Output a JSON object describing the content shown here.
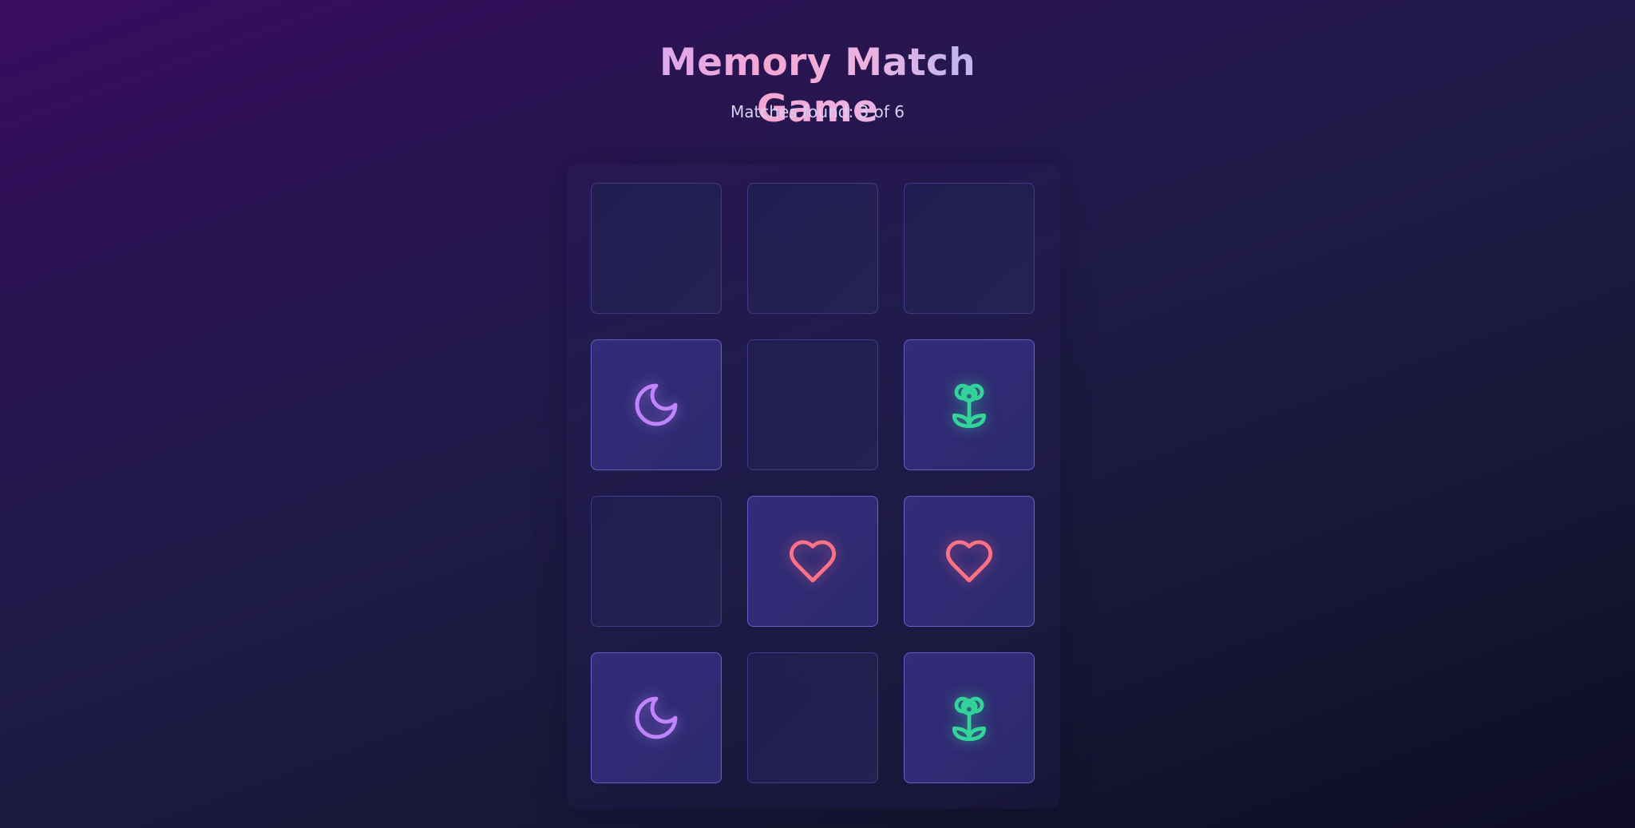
{
  "title": "Memory Match Game",
  "status": "Matches found: 3 of 6",
  "colors": {
    "moon": "#c084fc",
    "flower": "#34d399",
    "heart": "#fb7185"
  },
  "cards": [
    {
      "face_up": false,
      "icon": null
    },
    {
      "face_up": false,
      "icon": null
    },
    {
      "face_up": false,
      "icon": null
    },
    {
      "face_up": true,
      "icon": "moon-icon"
    },
    {
      "face_up": false,
      "icon": null
    },
    {
      "face_up": true,
      "icon": "flower-icon"
    },
    {
      "face_up": false,
      "icon": null
    },
    {
      "face_up": true,
      "icon": "heart-icon"
    },
    {
      "face_up": true,
      "icon": "heart-icon"
    },
    {
      "face_up": true,
      "icon": "moon-icon"
    },
    {
      "face_up": false,
      "icon": null
    },
    {
      "face_up": true,
      "icon": "flower-icon"
    }
  ]
}
